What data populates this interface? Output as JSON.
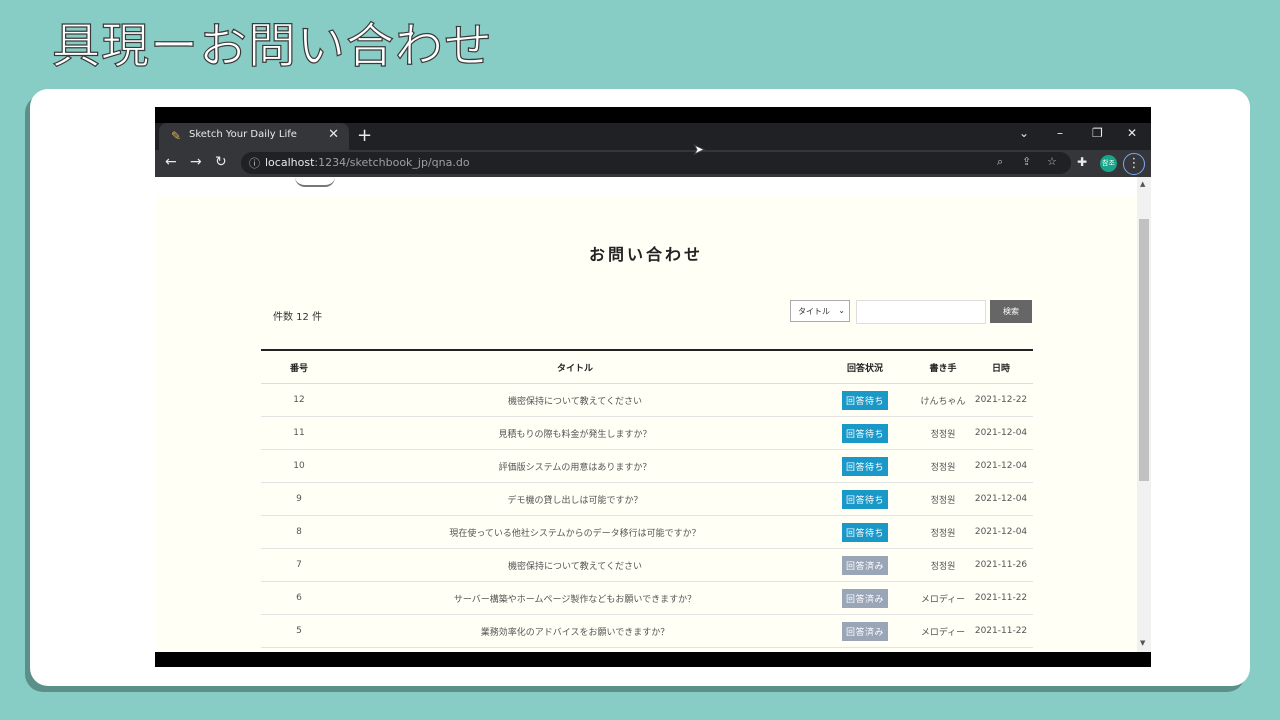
{
  "slide_title": "具現ーお問い合わせ",
  "browser": {
    "tab_title": "Sketch Your Daily Life",
    "url_host": "localhost",
    "url_rest": ":1234/sketchbook_jp/qna.do",
    "profile_label": "참조"
  },
  "page": {
    "title": "お問い合わせ",
    "count_text": "件数 12 件",
    "search": {
      "select_value": "タイトル",
      "input_value": "",
      "button_label": "検索"
    },
    "table": {
      "headers": [
        "番号",
        "タイトル",
        "回答状況",
        "書き手",
        "日時"
      ],
      "rows": [
        {
          "no": "12",
          "title": "機密保持について教えてください",
          "status": "回答待ち",
          "status_type": "waiting",
          "author": "けんちゃん",
          "date": "2021-12-22"
        },
        {
          "no": "11",
          "title": "見積もりの際も料金が発生しますか？",
          "status": "回答待ち",
          "status_type": "waiting",
          "author": "정정원",
          "date": "2021-12-04"
        },
        {
          "no": "10",
          "title": "評価版システムの用意はありますか？",
          "status": "回答待ち",
          "status_type": "waiting",
          "author": "정정원",
          "date": "2021-12-04"
        },
        {
          "no": "9",
          "title": "デモ機の貸し出しは可能ですか？",
          "status": "回答待ち",
          "status_type": "waiting",
          "author": "정정원",
          "date": "2021-12-04"
        },
        {
          "no": "8",
          "title": "現在使っている他社システムからのデータ移行は可能ですか？",
          "status": "回答待ち",
          "status_type": "waiting",
          "author": "정정원",
          "date": "2021-12-04"
        },
        {
          "no": "7",
          "title": "機密保持について教えてください",
          "status": "回答済み",
          "status_type": "done",
          "author": "정정원",
          "date": "2021-11-26"
        },
        {
          "no": "6",
          "title": "サーバー構築やホームページ製作などもお願いできますか？",
          "status": "回答済み",
          "status_type": "done",
          "author": "メロディー",
          "date": "2021-11-22"
        },
        {
          "no": "5",
          "title": "業務効率化のアドバイスをお願いできますか？",
          "status": "回答済み",
          "status_type": "done",
          "author": "メロディー",
          "date": "2021-11-22"
        }
      ]
    }
  },
  "colors": {
    "waiting": "#1a98c8",
    "done": "#9aa6b8",
    "background": "#88ccc6"
  }
}
